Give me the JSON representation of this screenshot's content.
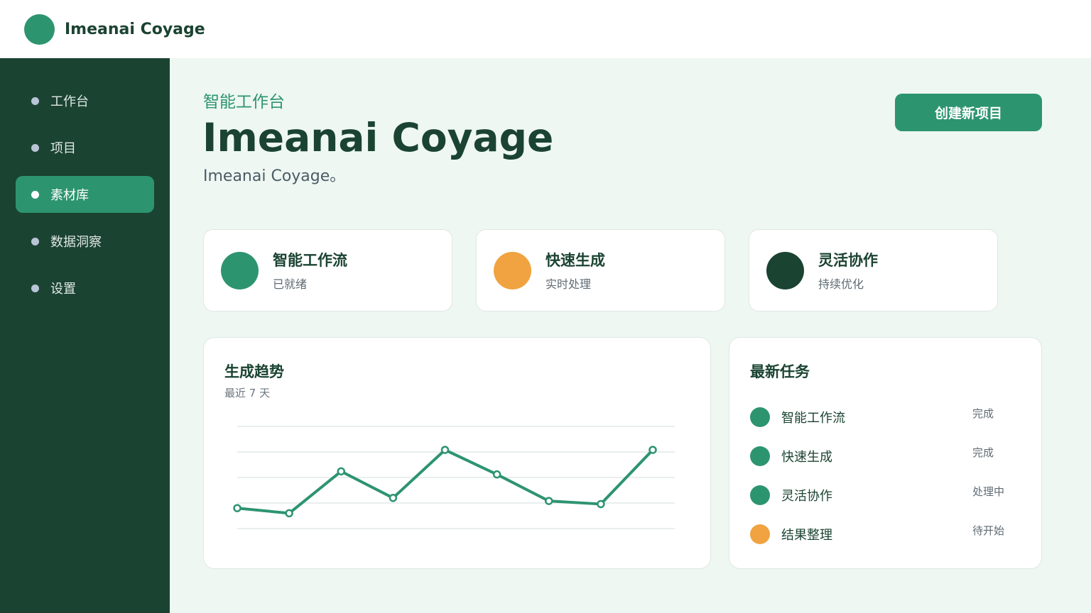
{
  "app": {
    "name": "Imeanai Coyage"
  },
  "colors": {
    "primary": "#2d9470",
    "dark": "#1b4332",
    "accent": "#f0a340",
    "background": "#eef7f2"
  },
  "sidebar": {
    "items": [
      {
        "label": "工作台",
        "active": false
      },
      {
        "label": "项目",
        "active": false
      },
      {
        "label": "素材库",
        "active": true
      },
      {
        "label": "数据洞察",
        "active": false
      },
      {
        "label": "设置",
        "active": false
      }
    ]
  },
  "hero": {
    "eyebrow": "智能工作台",
    "title": "Imeanai Coyage",
    "subtitle": "Imeanai Coyage。",
    "cta_label": "创建新项目"
  },
  "stats": [
    {
      "title": "智能工作流",
      "subtitle": "已就绪",
      "color": "#2d9470"
    },
    {
      "title": "快速生成",
      "subtitle": "实时处理",
      "color": "#f0a340"
    },
    {
      "title": "灵活协作",
      "subtitle": "持续优化",
      "color": "#1b4332"
    }
  ],
  "trend": {
    "title": "生成趋势",
    "subtitle": "最近 7 天"
  },
  "chart_data": {
    "type": "line",
    "title": "生成趋势",
    "subtitle": "最近 7 天",
    "grid": true,
    "ylim": [
      0,
      100
    ],
    "values": [
      20,
      15,
      56,
      30,
      77,
      53,
      27,
      24,
      77
    ]
  },
  "tasks": {
    "title": "最新任务",
    "items": [
      {
        "name": "智能工作流",
        "status": "完成",
        "color": "#2d9470"
      },
      {
        "name": "快速生成",
        "status": "完成",
        "color": "#2d9470"
      },
      {
        "name": "灵活协作",
        "status": "处理中",
        "color": "#2d9470"
      },
      {
        "name": "结果整理",
        "status": "待开始",
        "color": "#f0a340"
      }
    ]
  }
}
